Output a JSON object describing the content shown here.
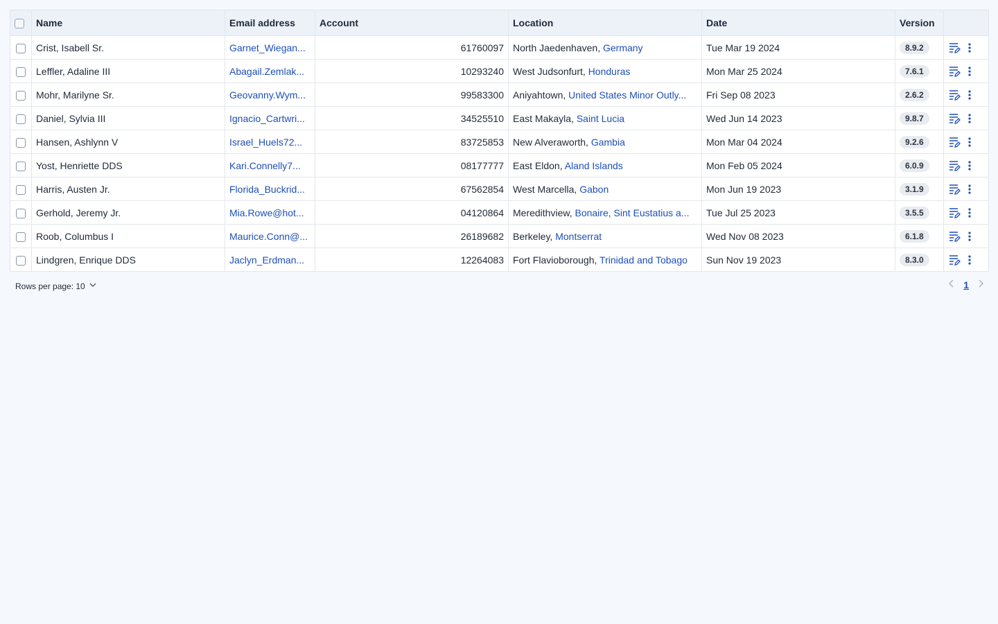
{
  "table": {
    "columns": [
      "Name",
      "Email address",
      "Account",
      "Location",
      "Date",
      "Version"
    ],
    "rows": [
      {
        "name": "Crist, Isabell Sr.",
        "email": "Garnet_Wiegan...",
        "account": "61760097",
        "city": "North Jaedenhaven, ",
        "country": "Germany",
        "date": "Tue Mar 19 2024",
        "version": "8.9.2"
      },
      {
        "name": "Leffler, Adaline III",
        "email": "Abagail.Zemlak...",
        "account": "10293240",
        "city": "West Judsonfurt, ",
        "country": "Honduras",
        "date": "Mon Mar 25 2024",
        "version": "7.6.1"
      },
      {
        "name": "Mohr, Marilyne Sr.",
        "email": "Geovanny.Wym...",
        "account": "99583300",
        "city": "Aniyahtown, ",
        "country": "United States Minor Outly...",
        "date": "Fri Sep 08 2023",
        "version": "2.6.2"
      },
      {
        "name": "Daniel, Sylvia III",
        "email": "Ignacio_Cartwri...",
        "account": "34525510",
        "city": "East Makayla, ",
        "country": "Saint Lucia",
        "date": "Wed Jun 14 2023",
        "version": "9.8.7"
      },
      {
        "name": "Hansen, Ashlynn V",
        "email": "Israel_Huels72...",
        "account": "83725853",
        "city": "New Alveraworth, ",
        "country": "Gambia",
        "date": "Mon Mar 04 2024",
        "version": "9.2.6"
      },
      {
        "name": "Yost, Henriette DDS",
        "email": "Kari.Connelly7...",
        "account": "08177777",
        "city": "East Eldon, ",
        "country": "Aland Islands",
        "date": "Mon Feb 05 2024",
        "version": "6.0.9"
      },
      {
        "name": "Harris, Austen Jr.",
        "email": "Florida_Buckrid...",
        "account": "67562854",
        "city": "West Marcella, ",
        "country": "Gabon",
        "date": "Mon Jun 19 2023",
        "version": "3.1.9"
      },
      {
        "name": "Gerhold, Jeremy Jr.",
        "email": "Mia.Rowe@hot...",
        "account": "04120864",
        "city": "Meredithview, ",
        "country": "Bonaire, Sint Eustatius a...",
        "date": "Tue Jul 25 2023",
        "version": "3.5.5"
      },
      {
        "name": "Roob, Columbus I",
        "email": "Maurice.Conn@...",
        "account": "26189682",
        "city": "Berkeley, ",
        "country": "Montserrat",
        "date": "Wed Nov 08 2023",
        "version": "6.1.8"
      },
      {
        "name": "Lindgren, Enrique DDS",
        "email": "Jaclyn_Erdman...",
        "account": "12264083",
        "city": "Fort Flavioborough, ",
        "country": "Trinidad and Tobago",
        "date": "Sun Nov 19 2023",
        "version": "8.3.0"
      }
    ]
  },
  "footer": {
    "rows_per_page_label": "Rows per page: 10",
    "current_page": "1"
  },
  "icons": {
    "row_edit": "edit-note-icon",
    "row_menu": "more-vertical-icon",
    "prev": "chevron-left-icon",
    "next": "chevron-right-icon",
    "rpp": "chevron-down-icon"
  },
  "colors": {
    "link": "#1d4fb8",
    "header_bg": "#edf2f9",
    "page_bg": "#f5f8fc",
    "badge_bg": "#e8ebef"
  }
}
